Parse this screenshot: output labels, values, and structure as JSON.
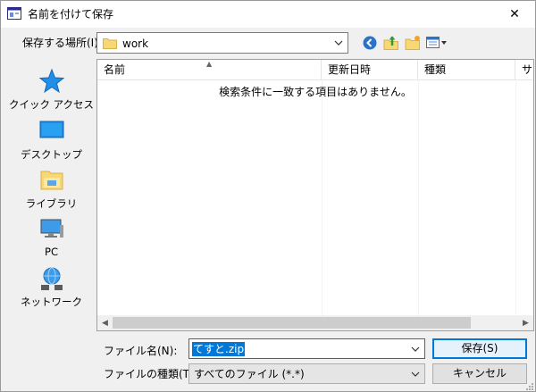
{
  "window": {
    "title": "名前を付けて保存",
    "close_glyph": "✕"
  },
  "location": {
    "label": "保存する場所(I):",
    "value": "work"
  },
  "places": [
    {
      "label": "クイック アクセス",
      "icon": "star-icon"
    },
    {
      "label": "デスクトップ",
      "icon": "desktop-icon"
    },
    {
      "label": "ライブラリ",
      "icon": "library-icon"
    },
    {
      "label": "PC",
      "icon": "computer-icon"
    },
    {
      "label": "ネットワーク",
      "icon": "network-icon"
    }
  ],
  "filelist": {
    "columns": {
      "name": "名前",
      "date": "更新日時",
      "type": "種類",
      "size": "サ"
    },
    "empty_message": "検索条件に一致する項目はありません。"
  },
  "filename": {
    "label": "ファイル名(N):",
    "value": "てすと.zip"
  },
  "filetype": {
    "label": "ファイルの種類(T):",
    "value": "すべてのファイル (*.*)"
  },
  "buttons": {
    "save": "保存(S)",
    "cancel": "キャンセル"
  },
  "colors": {
    "accent": "#0078d7",
    "folder": "#f8d775"
  }
}
